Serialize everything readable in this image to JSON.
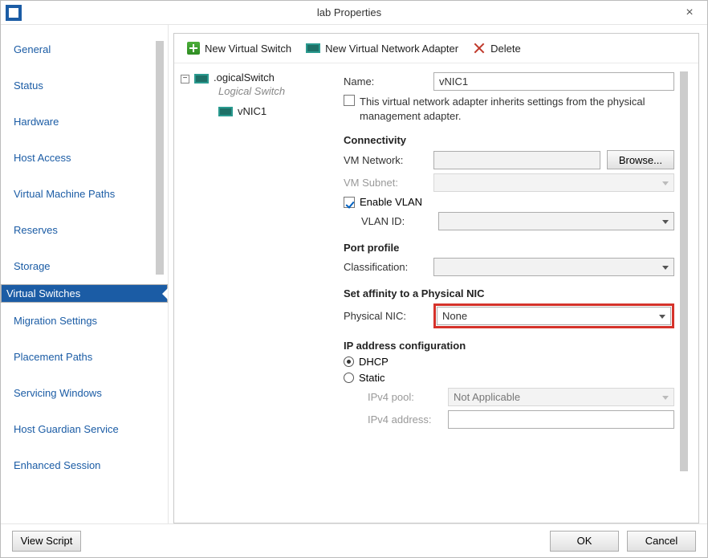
{
  "window": {
    "title": "lab Properties"
  },
  "sidebar": {
    "items": [
      {
        "label": "General"
      },
      {
        "label": "Status"
      },
      {
        "label": "Hardware"
      },
      {
        "label": "Host Access"
      },
      {
        "label": "Virtual Machine Paths"
      },
      {
        "label": "Reserves"
      },
      {
        "label": "Storage"
      },
      {
        "label": "Virtual Switches"
      },
      {
        "label": "Migration Settings"
      },
      {
        "label": "Placement Paths"
      },
      {
        "label": "Servicing Windows"
      },
      {
        "label": "Host Guardian Service"
      },
      {
        "label": "Enhanced Session"
      }
    ],
    "selected_index": 7
  },
  "toolbar": {
    "new_vswitch": "New Virtual Switch",
    "new_vna": "New Virtual Network Adapter",
    "delete": "Delete"
  },
  "tree": {
    "root_label": ".ogicalSwitch",
    "root_subtitle": "Logical Switch",
    "child_label": "vNIC1",
    "toggler": "⊟"
  },
  "form": {
    "name_label": "Name:",
    "name_value": "vNIC1",
    "inherit_text": "This virtual network adapter inherits settings from the physical management adapter.",
    "connectivity_heading": "Connectivity",
    "vm_network_label": "VM Network:",
    "vm_network_value": "",
    "browse_label": "Browse...",
    "vm_subnet_label": "VM Subnet:",
    "vm_subnet_value": "",
    "enable_vlan_label": "Enable VLAN",
    "vlan_id_label": "VLAN ID:",
    "vlan_id_value": "",
    "port_profile_heading": "Port profile",
    "classification_label": "Classification:",
    "classification_value": "",
    "affinity_heading": "Set affinity to a Physical NIC",
    "physical_nic_label": "Physical NIC:",
    "physical_nic_value": "None",
    "ipcfg_heading": "IP address configuration",
    "dhcp_label": "DHCP",
    "static_label": "Static",
    "ipv4_pool_label": "IPv4 pool:",
    "ipv4_pool_value": "Not Applicable",
    "ipv4_addr_label": "IPv4 address:",
    "ipv4_addr_value": ""
  },
  "footer": {
    "view_script": "View Script",
    "ok": "OK",
    "cancel": "Cancel"
  }
}
